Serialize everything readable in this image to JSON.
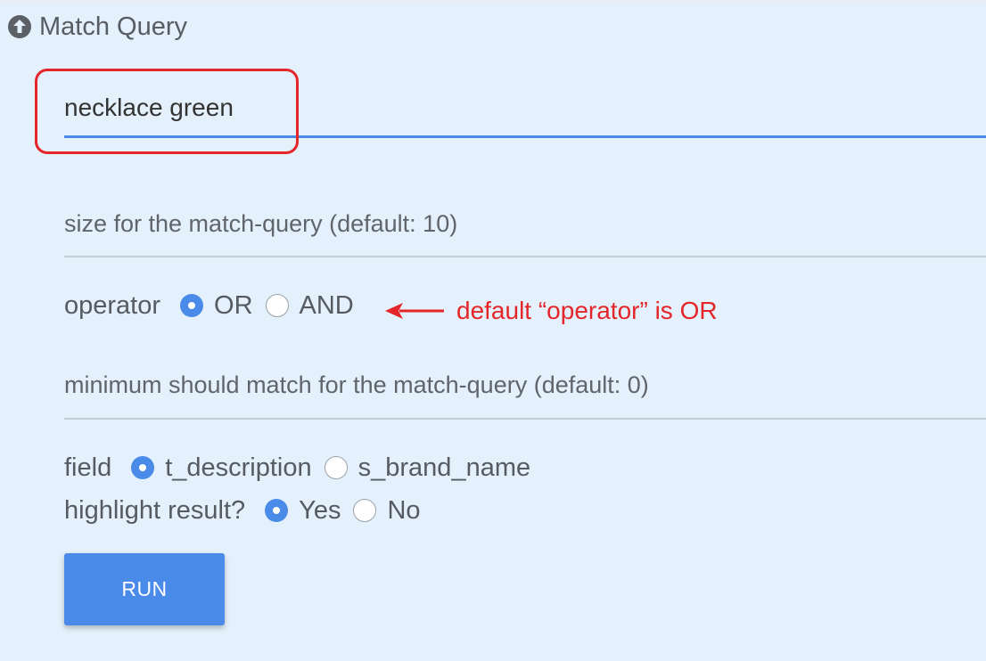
{
  "section": {
    "title": "Match Query",
    "collapse_icon": "circle-arrow-up-icon"
  },
  "query_input": {
    "value": "necklace green"
  },
  "size_field": {
    "placeholder": "size for the match-query (default: 10)",
    "value": ""
  },
  "operator": {
    "label": "operator",
    "options": [
      {
        "label": "OR",
        "checked": true
      },
      {
        "label": "AND",
        "checked": false
      }
    ]
  },
  "annotation": {
    "text": "default “operator” is OR",
    "color": "#e4262a"
  },
  "minimum_should_match_field": {
    "placeholder": "minimum should match for the match-query (default: 0)",
    "value": ""
  },
  "field": {
    "label": "field",
    "options": [
      {
        "label": "t_description",
        "checked": true
      },
      {
        "label": "s_brand_name",
        "checked": false
      }
    ]
  },
  "highlight": {
    "label": "highlight result?",
    "options": [
      {
        "label": "Yes",
        "checked": true
      },
      {
        "label": "No",
        "checked": false
      }
    ]
  },
  "run_button": {
    "label": "RUN"
  },
  "colors": {
    "accent": "#4a8ae8",
    "background": "#e4f0fb",
    "annotation_red": "#e4262a"
  }
}
